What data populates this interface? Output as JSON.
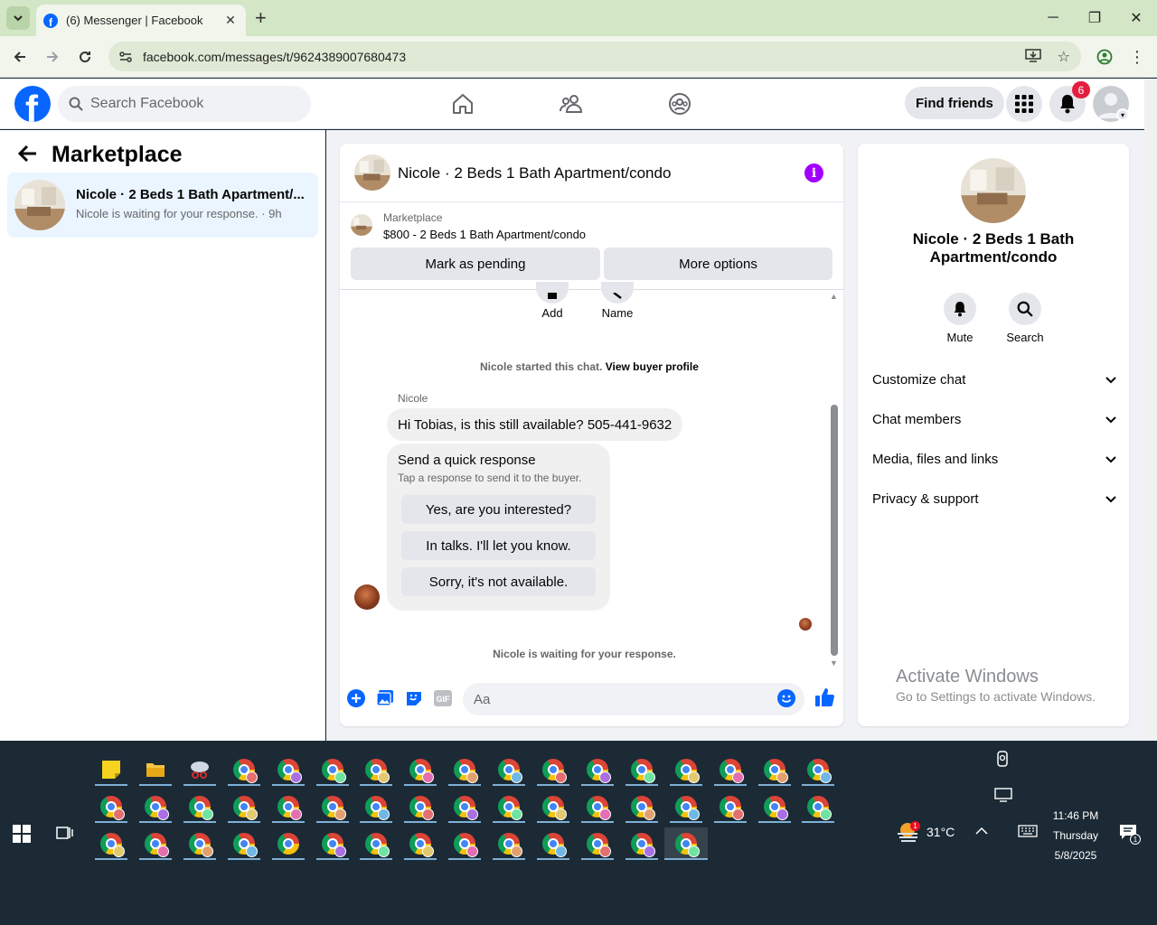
{
  "browser": {
    "tab_title": "(6) Messenger | Facebook",
    "url": "facebook.com/messages/t/9624389007680473"
  },
  "header": {
    "search_placeholder": "Search Facebook",
    "find_friends": "Find friends",
    "notification_count": "6"
  },
  "sidebar": {
    "title": "Marketplace",
    "conversation": {
      "title": "Nicole · 2 Beds 1 Bath Apartment/...",
      "subtitle": "Nicole is waiting for your response. · 9h"
    }
  },
  "chat": {
    "title": "Nicole · 2 Beds 1 Bath Apartment/condo",
    "listing_category": "Marketplace",
    "listing_desc": "$800 - 2 Beds 1 Bath Apartment/condo",
    "mark_pending": "Mark as pending",
    "more_options": "More options",
    "add_label": "Add",
    "name_label": "Name",
    "started_text": "Nicole started this chat.",
    "buyer_profile": "View buyer profile",
    "sender": "Nicole",
    "message": "Hi Tobias, is this still available? 505-441-9632",
    "quick_title": "Send a quick response",
    "quick_sub": "Tap a response to send it to the buyer.",
    "quick_replies": [
      "Yes, are you interested?",
      "In talks. I'll let you know.",
      "Sorry, it's not available."
    ],
    "waiting": "Nicole is waiting for your response.",
    "composer_placeholder": "Aa"
  },
  "info": {
    "name": "Nicole · 2 Beds 1 Bath Apartment/condo",
    "mute": "Mute",
    "search": "Search",
    "sections": [
      "Customize chat",
      "Chat members",
      "Media, files and links",
      "Privacy & support"
    ]
  },
  "watermark": {
    "line1": "Activate Windows",
    "line2": "Go to Settings to activate Windows."
  },
  "taskbar": {
    "weather_badge": "1",
    "temperature": "31°C",
    "time": "11:46 PM",
    "day": "Thursday",
    "date": "5/8/2025",
    "notif_count": "1"
  },
  "colors": {
    "brand": "#0866ff",
    "info_accent": "#a100ff",
    "badge": "#e41e3f",
    "selected_bg": "#ebf5ff"
  }
}
